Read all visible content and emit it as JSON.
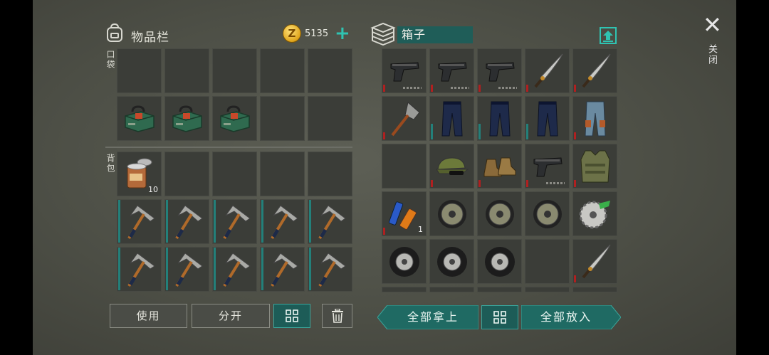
{
  "inventory": {
    "title": "物品栏",
    "coins": "5135",
    "coin_symbol": "Z",
    "pocket_label": "口袋",
    "backpack_label": "背包",
    "pocket_slots": [
      {
        "item": ""
      },
      {
        "item": ""
      },
      {
        "item": ""
      },
      {
        "item": ""
      },
      {
        "item": ""
      },
      {
        "item": "cash-box"
      },
      {
        "item": "cash-box"
      },
      {
        "item": "cash-box"
      },
      {
        "item": ""
      },
      {
        "item": ""
      }
    ],
    "backpack_slots": [
      {
        "item": "canned-food",
        "qty": "10"
      },
      {
        "item": ""
      },
      {
        "item": ""
      },
      {
        "item": ""
      },
      {
        "item": ""
      },
      {
        "item": "pickaxe"
      },
      {
        "item": "pickaxe"
      },
      {
        "item": "pickaxe"
      },
      {
        "item": "pickaxe"
      },
      {
        "item": "pickaxe"
      },
      {
        "item": "pickaxe"
      },
      {
        "item": "pickaxe"
      },
      {
        "item": "pickaxe"
      },
      {
        "item": "pickaxe"
      },
      {
        "item": "pickaxe"
      }
    ]
  },
  "box": {
    "name": "箱子",
    "slots": [
      {
        "item": "pistol"
      },
      {
        "item": "pistol"
      },
      {
        "item": "pistol"
      },
      {
        "item": "machete"
      },
      {
        "item": "machete"
      },
      {
        "item": "shovel"
      },
      {
        "item": "pants-dark"
      },
      {
        "item": "pants-dark"
      },
      {
        "item": "pants-dark"
      },
      {
        "item": "pants-light"
      },
      {
        "item": ""
      },
      {
        "item": "camo-cap"
      },
      {
        "item": "boots"
      },
      {
        "item": "pistol"
      },
      {
        "item": "vest"
      },
      {
        "item": "batteries",
        "qty": "1"
      },
      {
        "item": "disc"
      },
      {
        "item": "disc"
      },
      {
        "item": "disc"
      },
      {
        "item": "saw-blade"
      },
      {
        "item": "tire"
      },
      {
        "item": "tire"
      },
      {
        "item": "tire"
      },
      {
        "item": ""
      },
      {
        "item": "machete"
      }
    ]
  },
  "buttons": {
    "use": "使用",
    "split": "分开",
    "take_all": "全部拿上",
    "put_all": "全部放入"
  },
  "close": {
    "symbol": "✕",
    "label": "关闭"
  },
  "colors": {
    "accent_teal": "#1f6a63",
    "durability_red": "#b02020",
    "durability_teal": "#23807a"
  }
}
